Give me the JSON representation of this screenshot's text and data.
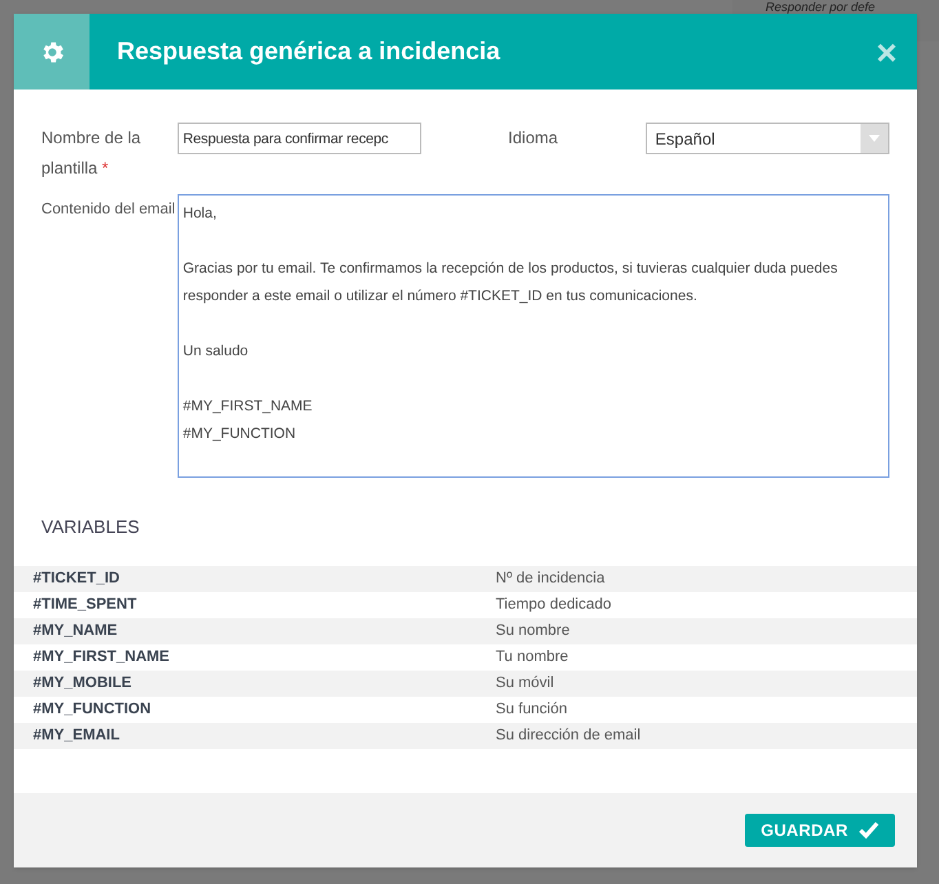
{
  "background": {
    "text": "Responder por defe"
  },
  "dialog": {
    "title": "Respuesta genérica a incidencia",
    "close": "×"
  },
  "form": {
    "name_label": "Nombre de la plantilla",
    "name_required": true,
    "required_mark": "*",
    "name_value": "Respuesta para confirmar recepc",
    "language_label": "Idioma",
    "language_value": "Español",
    "content_label": "Contenido del email",
    "content_paragraphs": [
      {
        "lines": [
          "Hola,"
        ]
      },
      {
        "lines": [
          "Gracias por tu email. Te confirmamos la recepción de los productos, si tuvieras cualquier duda puedes responder a este email o utilizar el número #TICKET_ID en tus comunicaciones."
        ]
      },
      {
        "lines": [
          "Un saludo"
        ]
      },
      {
        "lines": [
          "#MY_FIRST_NAME",
          "#MY_FUNCTION"
        ]
      }
    ]
  },
  "variables": {
    "title": "VARIABLES",
    "rows": [
      {
        "name": "#TICKET_ID",
        "description": "Nº de incidencia"
      },
      {
        "name": "#TIME_SPENT",
        "description": "Tiempo dedicado"
      },
      {
        "name": "#MY_NAME",
        "description": "Su nombre"
      },
      {
        "name": "#MY_FIRST_NAME",
        "description": "Tu nombre"
      },
      {
        "name": "#MY_MOBILE",
        "description": "Su móvil"
      },
      {
        "name": "#MY_FUNCTION",
        "description": "Su función"
      },
      {
        "name": "#MY_EMAIL",
        "description": "Su dirección de email"
      }
    ]
  },
  "footer": {
    "save": "GUARDAR"
  }
}
